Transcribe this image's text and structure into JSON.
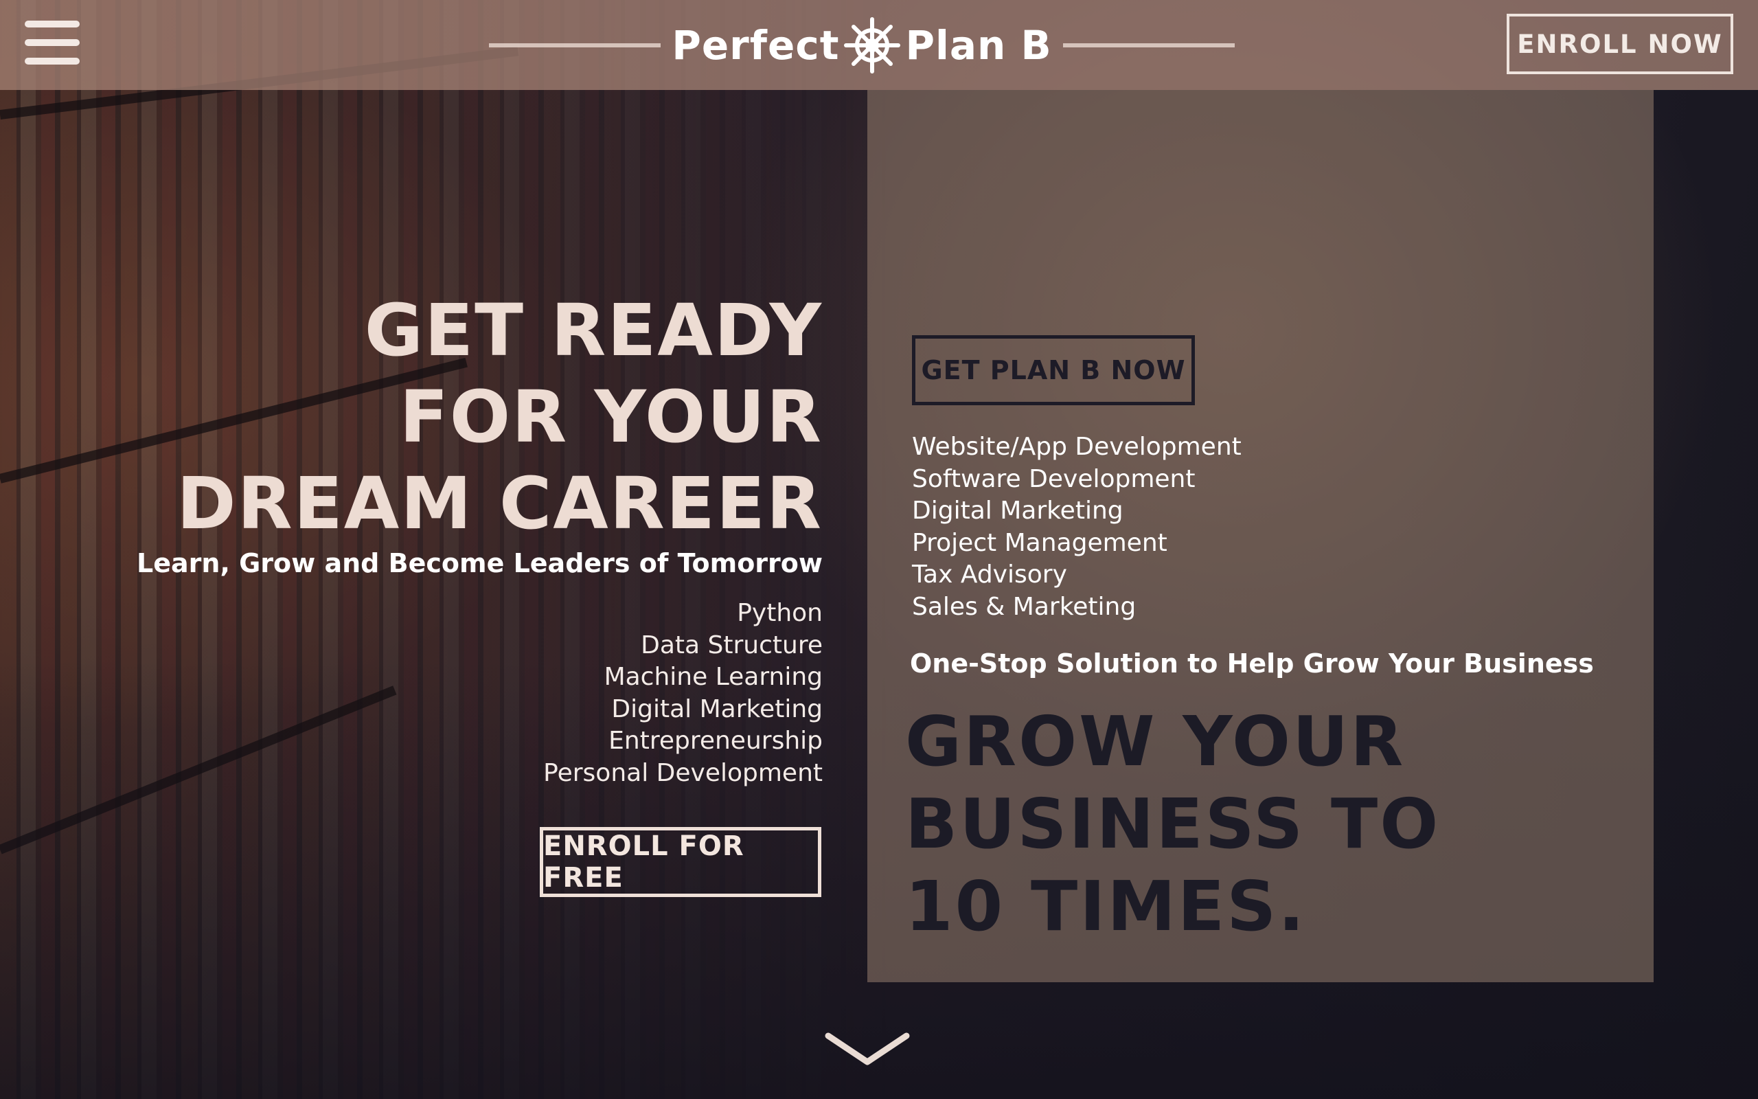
{
  "brand": {
    "name_left": "Perfect",
    "name_right": "Plan B",
    "logo_icon": "ship-wheel-icon"
  },
  "header": {
    "menu_icon": "hamburger-menu-icon",
    "enroll_now_label": "ENROLL NOW"
  },
  "hero": {
    "title_lines": [
      "GET READY",
      "FOR YOUR",
      "DREAM CAREER"
    ],
    "tagline": "Learn, Grow and Become Leaders of Tomorrow",
    "courses": [
      "Python",
      "Data Structure",
      "Machine Learning",
      "Digital Marketing",
      "Entrepreneurship",
      "Personal Development"
    ],
    "cta_label": "ENROLL FOR FREE"
  },
  "business": {
    "cta_label": "GET PLAN B NOW",
    "services": [
      "Website/App Development",
      "Software Development",
      "Digital Marketing",
      "Project Management",
      "Tax Advisory",
      "Sales & Marketing"
    ],
    "tagline": "One-Stop Solution to Help Grow Your Business",
    "title_lines": [
      "GROW YOUR",
      "BUSINESS TO",
      "10 TIMES."
    ]
  },
  "scroll": {
    "icon": "chevron-down-icon"
  },
  "colors": {
    "topbar": "#aa8778",
    "panel": "#968070",
    "hero_text": "#eddcd3",
    "dark_text": "#1c1b26",
    "background": "#1a1a26"
  }
}
